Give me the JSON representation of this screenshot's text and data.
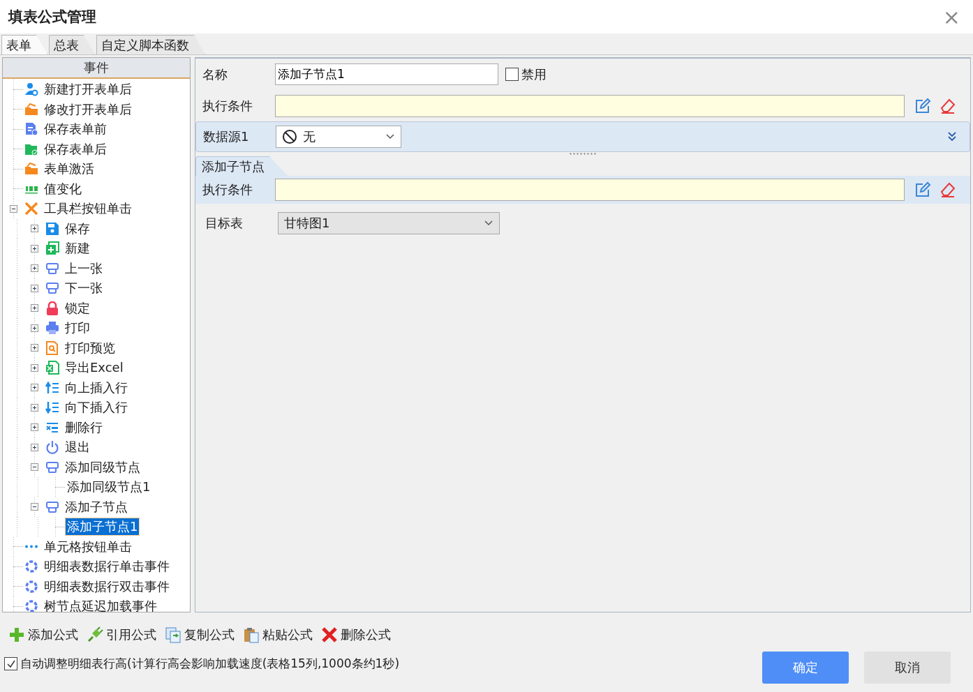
{
  "window": {
    "title": "填表公式管理",
    "close": "×"
  },
  "tabs": [
    {
      "label": "表单",
      "selected": true
    },
    {
      "label": "总表",
      "selected": false
    },
    {
      "label": "自定义脚本函数",
      "selected": false
    }
  ],
  "tree": {
    "header": "事件",
    "items": [
      {
        "label": "新建打开表单后",
        "kind": "user",
        "selected": false
      },
      {
        "label": "修改打开表单后",
        "kind": "folder",
        "selected": false
      },
      {
        "label": "保存表单前",
        "kind": "doc-check",
        "selected": false
      },
      {
        "label": "保存表单后",
        "kind": "folder-check",
        "selected": false
      },
      {
        "label": "表单激活",
        "kind": "folder",
        "selected": false
      },
      {
        "label": "值变化",
        "kind": "number",
        "selected": false
      },
      {
        "label": "工具栏按钮单击",
        "kind": "tools",
        "selected": false,
        "expanded": true,
        "children": [
          {
            "label": "保存",
            "kind": "save",
            "selected": false,
            "expanded": false
          },
          {
            "label": "新建",
            "kind": "new",
            "selected": false,
            "expanded": false
          },
          {
            "label": "上一张",
            "kind": "node",
            "selected": false,
            "expanded": false
          },
          {
            "label": "下一张",
            "kind": "node",
            "selected": false,
            "expanded": false
          },
          {
            "label": "锁定",
            "kind": "lock",
            "selected": false,
            "expanded": false
          },
          {
            "label": "打印",
            "kind": "print",
            "selected": false,
            "expanded": false
          },
          {
            "label": "打印预览",
            "kind": "preview",
            "selected": false,
            "expanded": false
          },
          {
            "label": "导出Excel",
            "kind": "excel",
            "selected": false,
            "expanded": false
          },
          {
            "label": "向上插入行",
            "kind": "insert-up",
            "selected": false,
            "expanded": false
          },
          {
            "label": "向下插入行",
            "kind": "insert-down",
            "selected": false,
            "expanded": false
          },
          {
            "label": "删除行",
            "kind": "delete-row",
            "selected": false,
            "expanded": false
          },
          {
            "label": "退出",
            "kind": "power",
            "selected": false,
            "expanded": false
          },
          {
            "label": "添加同级节点",
            "kind": "node",
            "selected": false,
            "expanded": true,
            "children": [
              {
                "label": "添加同级节点1",
                "selected": false
              }
            ]
          },
          {
            "label": "添加子节点",
            "kind": "node",
            "selected": false,
            "expanded": true,
            "children": [
              {
                "label": "添加子节点1",
                "selected": true
              }
            ]
          }
        ]
      },
      {
        "label": "单元格按钮单击",
        "kind": "dots",
        "selected": false
      },
      {
        "label": "明细表数据行单击事件",
        "kind": "ring",
        "selected": false
      },
      {
        "label": "明细表数据行双击事件",
        "kind": "ring",
        "selected": false
      },
      {
        "label": "树节点延迟加载事件",
        "kind": "ring",
        "selected": false
      }
    ]
  },
  "form": {
    "name_label": "名称",
    "name_value": "添加子节点1",
    "disabled": {
      "label": "禁用",
      "checked": false
    },
    "condition_label": "执行条件"
  },
  "datasource": {
    "label": "数据源1",
    "value": "无"
  },
  "subtab": {
    "label": "添加子节点",
    "condition_label": "执行条件",
    "target_label": "目标表",
    "target_value": "甘特图1"
  },
  "toolbar": [
    {
      "label": "添加公式",
      "kind": "add"
    },
    {
      "label": "引用公式",
      "kind": "reference"
    },
    {
      "label": "复制公式",
      "kind": "copy"
    },
    {
      "label": "粘贴公式",
      "kind": "paste"
    },
    {
      "label": "删除公式",
      "kind": "delete"
    }
  ],
  "auto_height": {
    "label": "自动调整明细表行高(计算行高会影响加载速度(表格15列,1000条约1秒)",
    "checked": true
  },
  "buttons": [
    {
      "label": "确定",
      "primary": true
    },
    {
      "label": "取消",
      "primary": false
    }
  ]
}
